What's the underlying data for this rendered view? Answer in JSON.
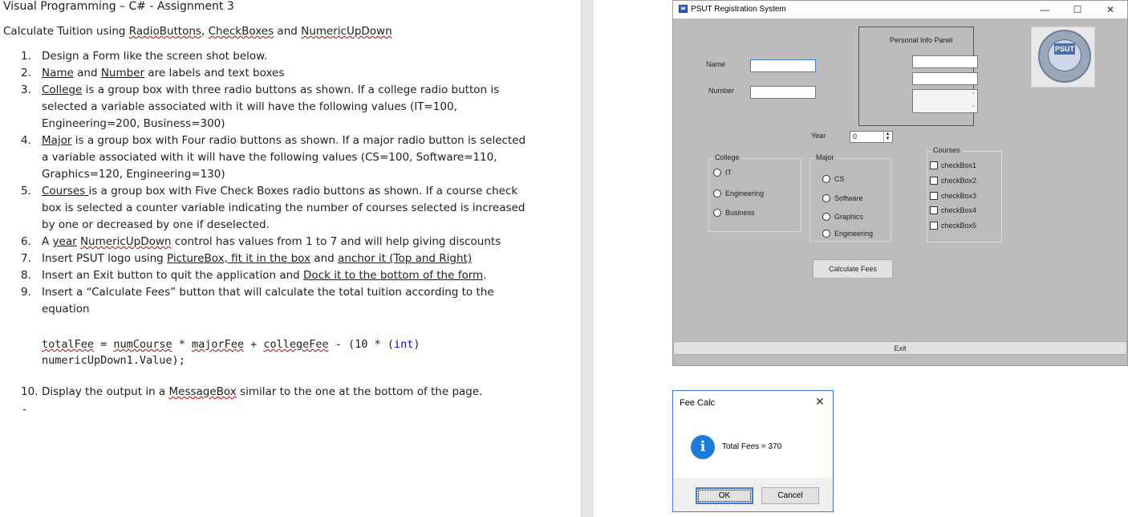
{
  "document": {
    "title": "Visual Programming – C# - Assignment 3",
    "subtitle": {
      "prefix": "Calculate Tuition using ",
      "a": "RadioButtons",
      "sep1": ", ",
      "b": "CheckBoxes",
      "sep2": " and ",
      "c": "NumericUpDown"
    },
    "items": [
      {
        "num": "1.",
        "text": "Design a Form like the screen shot below."
      },
      {
        "num": "2.",
        "pre": "",
        "u1": "Name",
        "mid": " and ",
        "u2": "Number",
        "post": " are labels and text boxes"
      },
      {
        "num": "3.",
        "u1": "College",
        "text": " is a group box with three radio buttons as shown. If a college radio button is selected a variable associated with it will have the following values (IT=100, Engineering=200, Business=300)"
      },
      {
        "num": "4.",
        "u1": "Major",
        "text": " is a group box with Four radio buttons as shown. If a major radio button is selected a variable associated with it will have the following values (CS=100, Software=110, Graphics=120, Engineering=130)"
      },
      {
        "num": "5.",
        "u1": "Courses ",
        "text": "is a group box with Five Check Boxes radio buttons as shown. If a course check box is selected a counter variable indicating the number of courses selected is increased by one or decreased by one if deselected."
      },
      {
        "num": "6.",
        "pre": "A ",
        "u1": "year",
        "mid": " ",
        "u2": "NumericUpDown",
        "post": " control has values from 1 to 7 and will help giving discounts"
      },
      {
        "num": "7.",
        "pre": "Insert PSUT logo using ",
        "u1": "PictureBox, fit it in the box",
        "mid": "  and ",
        "u2": "anchor it (Top and Right)",
        "post": ""
      },
      {
        "num": "8.",
        "pre": "Insert an Exit button to quit the application and ",
        "u1": "Dock it to the bottom of the form",
        "post": "."
      },
      {
        "num": "9.",
        "text": "Insert a “Calculate Fees” button that will calculate the total tuition according to the equation"
      }
    ],
    "code": {
      "line1": {
        "a": "totalFee",
        "b": " = ",
        "c": "numCourse",
        "d": " * ",
        "e": "majorFee",
        "f": " + ",
        "g": "collegeFee",
        "h": " - (10 * (",
        "kw": "int",
        "i": ")"
      },
      "line2": "numericUpDown1.Value);"
    },
    "item10": {
      "num": "10.",
      "pre": "Display the output in a ",
      "u1": "MessageBox",
      "post": " similar to the one at the bottom of the page."
    },
    "dash": "-"
  },
  "form": {
    "title": "PSUT Registration System",
    "controls": {
      "minimize": "—",
      "maximize": "☐",
      "close": "✕"
    },
    "name_label": "Name",
    "number_label": "Number",
    "personal_panel_label": "Personal Info Panel",
    "year_label": "Year",
    "year_value": "0",
    "college": {
      "caption": "College",
      "options": [
        "IT",
        "Engineering",
        "Business"
      ]
    },
    "major": {
      "caption": "Major",
      "options": [
        "CS",
        "Software",
        "Graphics",
        "Engineering"
      ]
    },
    "courses": {
      "caption": "Courses",
      "options": [
        "checkBox1",
        "checkBox2",
        "checkBox3",
        "checkBox4",
        "checkBox5"
      ]
    },
    "calc_button": "Calculate Fees",
    "exit_button": "Exit",
    "logo_text": "PSUT"
  },
  "messagebox": {
    "title": "Fee Calc",
    "close": "✕",
    "icon": "i",
    "text": "Total Fees = 370",
    "ok": "OK",
    "cancel": "Cancel"
  }
}
